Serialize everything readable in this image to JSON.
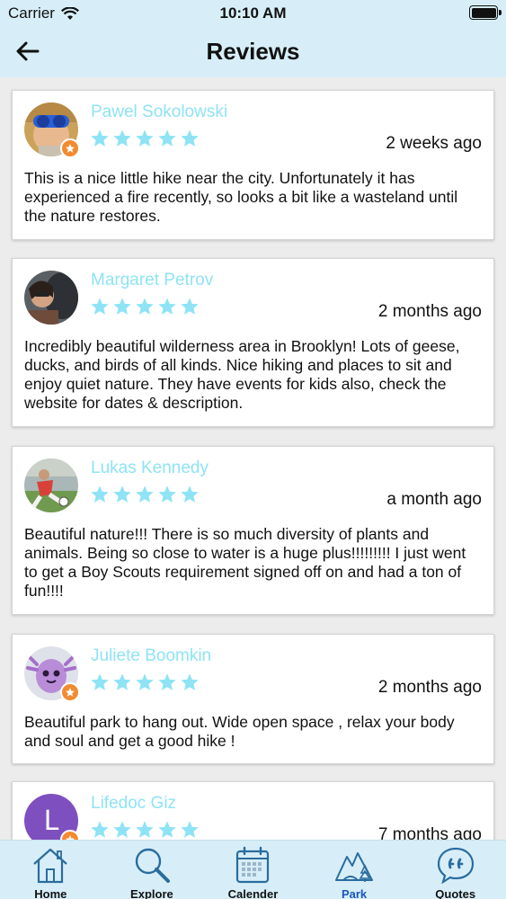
{
  "status_bar": {
    "carrier": "Carrier",
    "time": "10:10 AM"
  },
  "header": {
    "title": "Reviews"
  },
  "reviews": [
    {
      "name": "Pawel Sokolowski",
      "rating": 5,
      "time": "2 weeks ago",
      "text": "This is a nice little hike near the city. Unfortunately it has experienced a fire recently, so looks a bit like a wasteland until the nature restores."
    },
    {
      "name": "Margaret Petrov",
      "rating": 5,
      "time": "2 months ago",
      "text": "Incredibly beautiful wilderness area in Brooklyn! Lots of geese, ducks, and birds of all kinds. Nice hiking and places to sit and enjoy quiet nature. They have events for kids also, check the website for dates & description."
    },
    {
      "name": "Lukas Kennedy",
      "rating": 5,
      "time": "a month ago",
      "text": "Beautiful nature!!! There is so much diversity of plants and animals. Being so close to water is a huge plus!!!!!!!!! I just went to get a Boy Scouts requirement signed off on and had a ton of fun!!!!"
    },
    {
      "name": "Juliete Boomkin",
      "rating": 5,
      "time": "2 months ago",
      "text": "Beautiful park to hang out. Wide open space , relax your body and soul and get a good hike !"
    },
    {
      "name": "Lifedoc Giz",
      "avatar_letter": "L",
      "rating": 5,
      "time": "7 months ago",
      "text": ""
    }
  ],
  "tabs": [
    {
      "label": "Home",
      "icon": "house-icon"
    },
    {
      "label": "Explore",
      "icon": "magnifier-icon"
    },
    {
      "label": "Calender",
      "icon": "calendar-icon"
    },
    {
      "label": "Park",
      "icon": "park-icon",
      "active": true
    },
    {
      "label": "Quotes",
      "icon": "quote-bubble-icon"
    }
  ],
  "colors": {
    "header_bg": "#d7eef8",
    "name": "#8ee3f5",
    "star": "#8ee3f5",
    "badge": "#f28b30",
    "active_tab": "#1a56c0",
    "icon": "#2a6c9e"
  }
}
